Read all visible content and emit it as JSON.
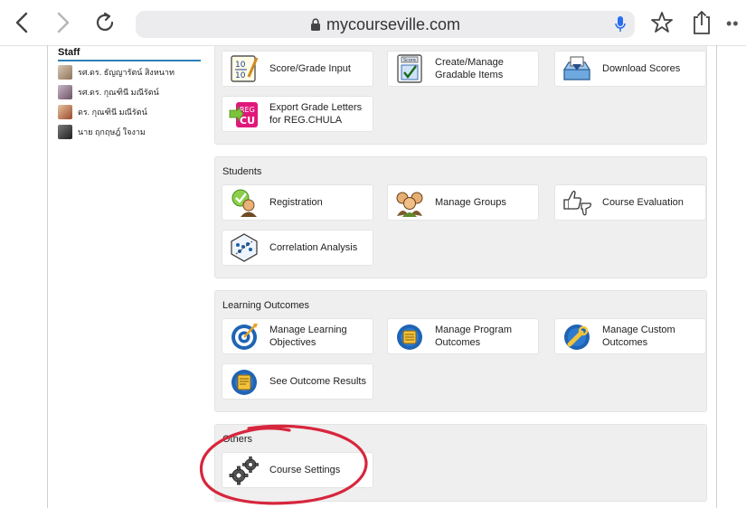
{
  "browser": {
    "url": "mycourseville.com"
  },
  "staff": {
    "title": "Staff",
    "members": [
      {
        "name": "รศ.ดร. ธัญญารัตน์ สิงหนาท"
      },
      {
        "name": "รศ.ดร. กุณฑินี มณีรัตน์"
      },
      {
        "name": "ดร. กุณฑินี มณีรัตน์"
      },
      {
        "name": "นาย ฤกฤษฎ์ ใจงาม"
      }
    ]
  },
  "sections": {
    "grading": {
      "items": [
        {
          "label": "Score/Grade Input",
          "icon": "score-input-icon"
        },
        {
          "label": "Create/Manage Gradable Items",
          "icon": "gradable-items-icon"
        },
        {
          "label": "Download Scores",
          "icon": "download-tray-icon"
        },
        {
          "label": "Export Grade Letters for REG.CHULA",
          "icon": "reg-cu-icon",
          "badge_top": "REG",
          "badge_bottom": "CU"
        }
      ]
    },
    "students": {
      "title": "Students",
      "items": [
        {
          "label": "Registration",
          "icon": "registration-icon"
        },
        {
          "label": "Manage Groups",
          "icon": "group-icon"
        },
        {
          "label": "Course Evaluation",
          "icon": "thumbs-up-down-icon"
        },
        {
          "label": "Correlation Analysis",
          "icon": "correlation-icon"
        }
      ]
    },
    "outcomes": {
      "title": "Learning Outcomes",
      "items": [
        {
          "label": "Manage Learning Objectives",
          "icon": "target-icon"
        },
        {
          "label": "Manage Program Outcomes",
          "icon": "program-outcome-icon"
        },
        {
          "label": "Manage Custom Outcomes",
          "icon": "custom-outcome-icon"
        },
        {
          "label": "See Outcome Results",
          "icon": "outcome-results-icon"
        }
      ]
    },
    "others": {
      "title": "Others",
      "items": [
        {
          "label": "Course Settings",
          "icon": "gears-icon"
        }
      ]
    }
  },
  "colors": {
    "accent_blue": "#2f7fb8",
    "annotation_red": "#d7263d",
    "section_bg": "#efefef"
  }
}
